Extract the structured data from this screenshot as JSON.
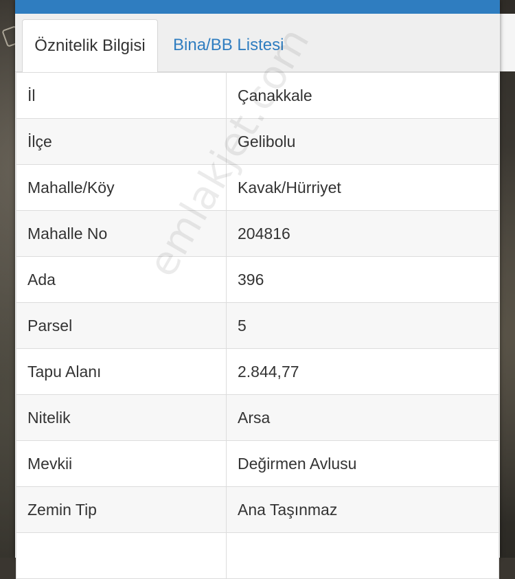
{
  "tabs": [
    {
      "label": "Öznitelik Bilgisi",
      "active": true
    },
    {
      "label": "Bina/BB Listesi",
      "active": false
    }
  ],
  "rows": [
    {
      "key": "İl",
      "value": "Çanakkale"
    },
    {
      "key": "İlçe",
      "value": "Gelibolu"
    },
    {
      "key": "Mahalle/Köy",
      "value": "Kavak/Hürriyet"
    },
    {
      "key": "Mahalle No",
      "value": "204816"
    },
    {
      "key": "Ada",
      "value": "396"
    },
    {
      "key": "Parsel",
      "value": "5"
    },
    {
      "key": "Tapu Alanı",
      "value": "2.844,77"
    },
    {
      "key": "Nitelik",
      "value": "Arsa"
    },
    {
      "key": "Mevkii",
      "value": "Değirmen Avlusu"
    },
    {
      "key": "Zemin Tip",
      "value": "Ana Taşınmaz"
    },
    {
      "key": "",
      "value": ""
    }
  ],
  "watermark": "emlakjet.com",
  "colors": {
    "accent": "#2f7dc0",
    "panel": "#efefef"
  }
}
